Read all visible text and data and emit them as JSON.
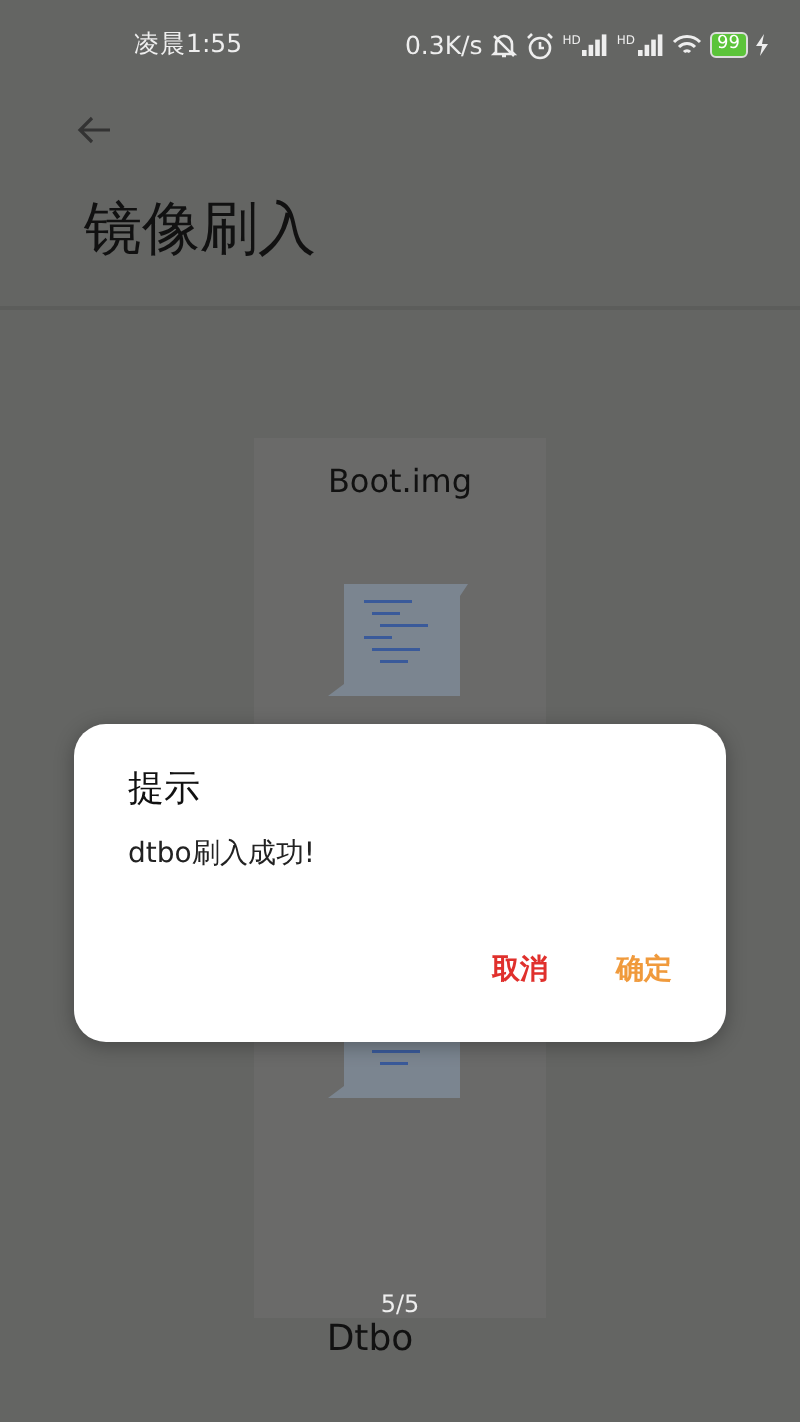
{
  "status_bar": {
    "time": "凌晨1:55",
    "speed": "0.3K/s",
    "signals": [
      {
        "label": "HD"
      },
      {
        "label": "HD"
      }
    ],
    "battery": "99"
  },
  "header": {
    "title": "镜像刷入"
  },
  "images": [
    {
      "name": "Boot.img",
      "kind": "document"
    },
    {
      "kind": "document"
    }
  ],
  "pager": {
    "position": "5/5",
    "name": "Dtbo"
  },
  "dialog": {
    "title": "提示",
    "message": "dtbo刷入成功!",
    "buttons": [
      {
        "label": "取消",
        "color": "#e0302c"
      },
      {
        "label": "确定",
        "color": "#f09a3c"
      }
    ]
  }
}
